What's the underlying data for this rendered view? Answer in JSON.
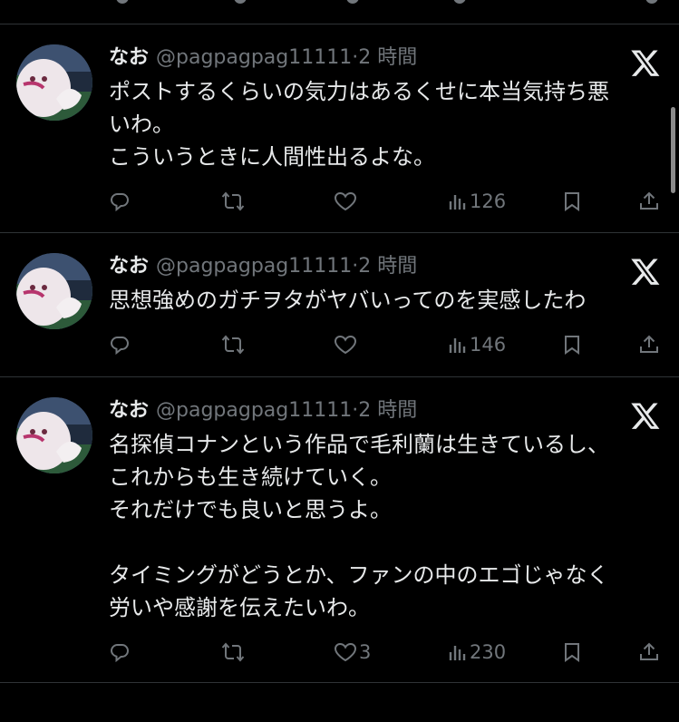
{
  "posts": [
    {
      "name": "なお",
      "handle": "@pagpagpag11111",
      "dot": "·",
      "time": "2 時間",
      "text": "ポストするくらいの気力はあるくせに本当気持ち悪\nいわ。\nこういうときに人間性出るよな。",
      "likes": "",
      "views": "126"
    },
    {
      "name": "なお",
      "handle": "@pagpagpag11111",
      "dot": "·",
      "time": "2 時間",
      "text": "思想強めのガチヲタがヤバいってのを実感したわ",
      "likes": "",
      "views": "146"
    },
    {
      "name": "なお",
      "handle": "@pagpagpag11111",
      "dot": "·",
      "time": "2 時間",
      "text": "名探偵コナンという作品で毛利蘭は生きているし、\nこれからも生き続けていく。\nそれだけでも良いと思うよ。\n\nタイミングがどうとか、ファンの中のエゴじゃなく\n労いや感謝を伝えたいわ。",
      "likes": "3",
      "views": "230"
    }
  ],
  "icons": {
    "reply": "reply-icon",
    "repost": "repost-icon",
    "like": "heart-icon",
    "views": "views-icon",
    "bookmark": "bookmark-icon",
    "share": "share-icon",
    "more": "x-logo-icon"
  },
  "colors": {
    "background": "#000000",
    "text": "#e7e9ea",
    "secondary": "#71767b",
    "divider": "#2f3336"
  }
}
